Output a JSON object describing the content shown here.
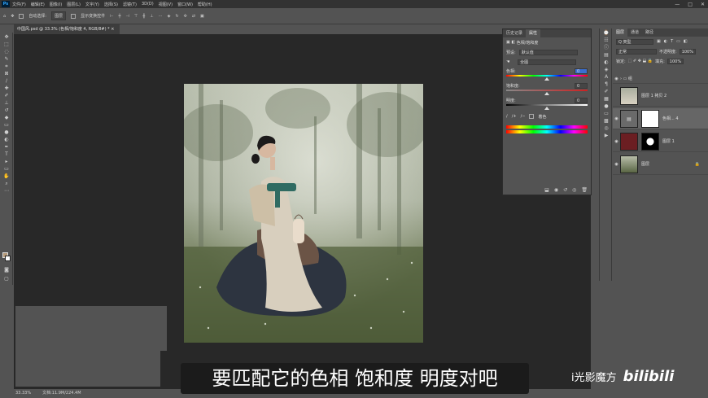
{
  "menu": {
    "logo": "Ps",
    "items": [
      "文件(F)",
      "编辑(E)",
      "图像(I)",
      "图层(L)",
      "文字(Y)",
      "选择(S)",
      "滤镜(T)",
      "3D(D)",
      "视图(V)",
      "窗口(W)",
      "帮助(H)"
    ]
  },
  "window_controls": {
    "minimize": "—",
    "maximize": "□",
    "close": "✕"
  },
  "options_bar": {
    "auto_select_label": "自动选择:",
    "auto_select_value": "图层",
    "show_transform_label": "显示变换控件"
  },
  "document_tab": {
    "title": "中国风.psd @ 33.3% (色相/饱和度 4, RGB/8#) *",
    "close": "×"
  },
  "status_bar": {
    "zoom": "33.33%",
    "doc_info": "文档:11.9M/224.4M"
  },
  "properties_panel": {
    "tabs": [
      "历史记录",
      "属性"
    ],
    "header_label": "色相/饱和度",
    "preset_label": "预设:",
    "preset_value": "默认值",
    "channel_value": "全图",
    "hue_label": "色相:",
    "hue_value": "0",
    "saturation_label": "饱和度:",
    "saturation_value": "0",
    "lightness_label": "明度:",
    "lightness_value": "0",
    "colorize_label": "着色"
  },
  "layers_panel": {
    "tabs": [
      "图层",
      "通道",
      "路径"
    ],
    "filter_label": "Q 类型",
    "blend_mode": "正常",
    "opacity_label": "不透明度:",
    "opacity_value": "100%",
    "lock_label": "锁定:",
    "fill_label": "填充:",
    "fill_value": "100%",
    "layers": [
      {
        "name": "组",
        "type": "group"
      },
      {
        "name": "图层 1 拷贝 2",
        "type": "pixel"
      },
      {
        "name": "色相... 4",
        "type": "adjustment"
      },
      {
        "name": "图层 1",
        "type": "pixel"
      },
      {
        "name": "图层",
        "type": "background"
      }
    ]
  },
  "subtitle": "要匹配它的色相 饱和度 明度对吧",
  "watermark": {
    "channel": "i光影魔方",
    "logo": "bilibili"
  },
  "colors": {
    "ps_blue": "#31a8ff",
    "panel_bg": "#535353",
    "canvas_bg": "#282828"
  }
}
